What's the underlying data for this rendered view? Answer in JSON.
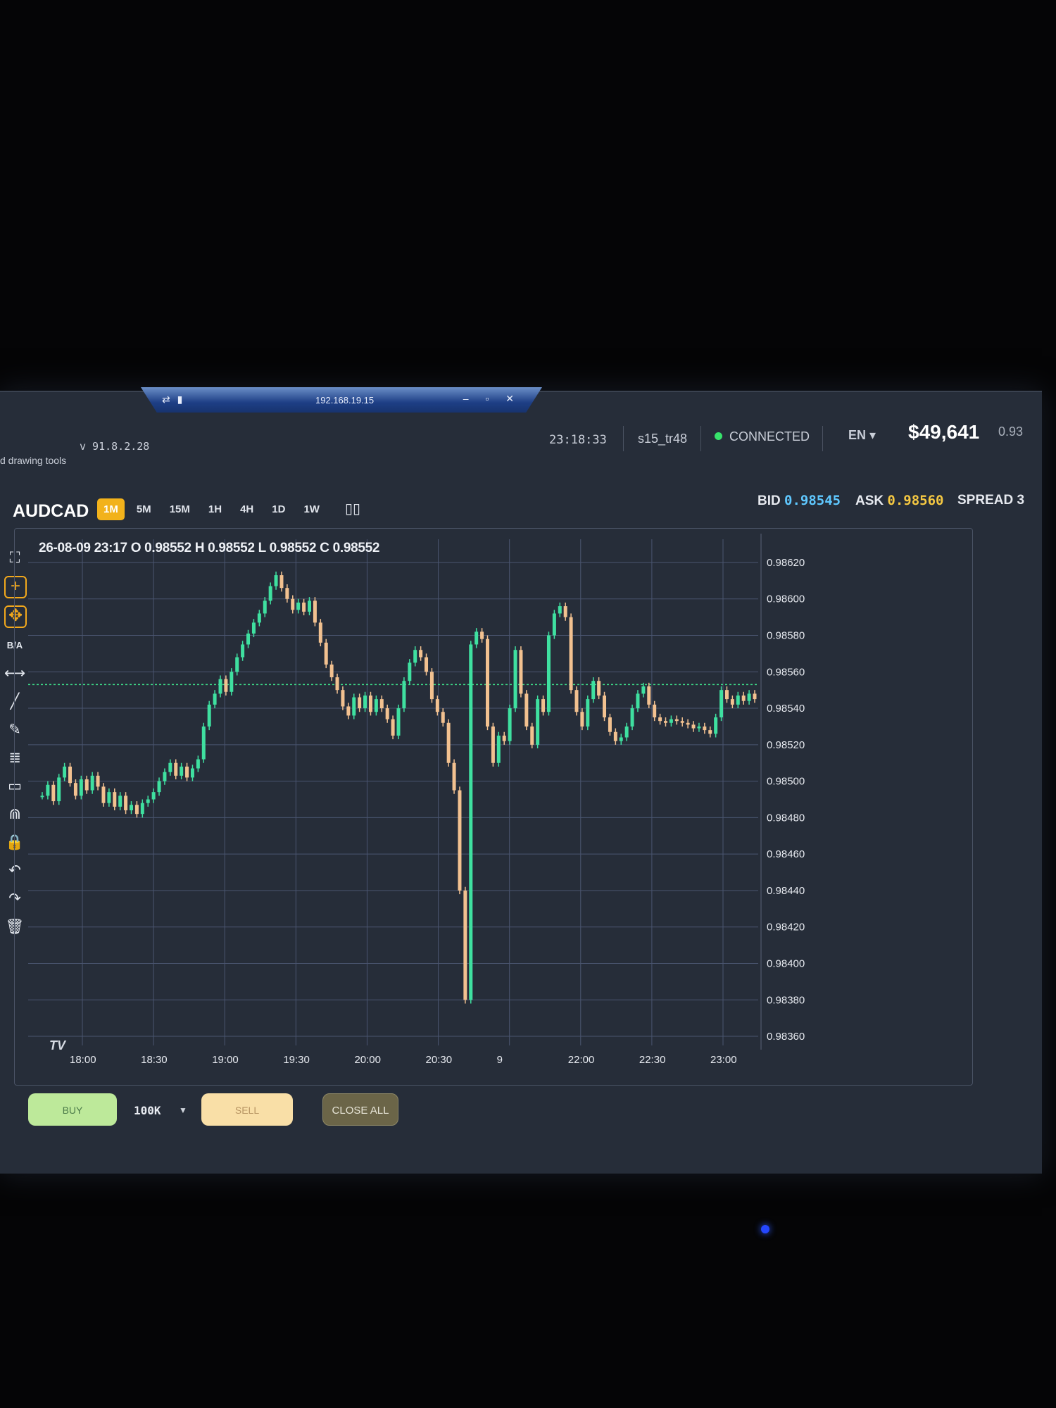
{
  "remote_window": {
    "title": "192.168.19.15",
    "left_icons": "⇄ ▮",
    "controls": "– ▫ ✕"
  },
  "header": {
    "version": "v 91.8.2.28",
    "drawing_tools": "d drawing tools",
    "clock": "23:18:33",
    "user": "s15_tr48",
    "status": "CONNECTED",
    "language": "EN ▾",
    "balance": "$49,641",
    "ratio": "0.93"
  },
  "symbol_bar": {
    "symbol": "AUDCAD",
    "timeframes": [
      "1M",
      "5M",
      "15M",
      "1H",
      "4H",
      "1D",
      "1W"
    ],
    "active_timeframe": "1M",
    "chart_type_icon": "candles-icon",
    "bid_label": "BID",
    "bid_value": "0.98545",
    "ask_label": "ASK",
    "ask_value": "0.98560",
    "spread_label": "SPREAD",
    "spread_value": "3"
  },
  "toolbar": {
    "items": [
      {
        "icon": "fullscreen-icon",
        "glyph": "⛶"
      },
      {
        "icon": "crosshair-icon",
        "glyph": "+"
      },
      {
        "icon": "move-icon",
        "glyph": "✥"
      },
      {
        "icon": "bid-ask-icon",
        "glyph": "B/A"
      },
      {
        "icon": "horizontal-line-icon",
        "glyph": "⟷"
      },
      {
        "icon": "trend-line-icon",
        "glyph": "╱"
      },
      {
        "icon": "pencil-icon",
        "glyph": "✎"
      },
      {
        "icon": "fib-icon",
        "glyph": "≣"
      },
      {
        "icon": "rectangle-icon",
        "glyph": "▭"
      },
      {
        "icon": "magnet-icon",
        "glyph": "⋒"
      },
      {
        "icon": "lock-icon",
        "glyph": "🔒"
      },
      {
        "icon": "undo-icon",
        "glyph": "↶"
      },
      {
        "icon": "redo-icon",
        "glyph": "↷"
      },
      {
        "icon": "trash-icon",
        "glyph": "🗑"
      }
    ]
  },
  "ohlc_legend": "26-08-09 23:17 O 0.98552 H 0.98552 L 0.98552 C 0.98552",
  "tv_logo": "TV",
  "trade_bar": {
    "buy_label": "BUY",
    "quantity": "100K",
    "sell_label": "SELL",
    "close_all_label": "CLOSE ALL"
  },
  "colors": {
    "up": "#3fe0a0",
    "down": "#f2c190",
    "grid": "#4a5570",
    "bid_line": "#3ee08a",
    "accent": "#f2b21b"
  },
  "chart_data": {
    "type": "line",
    "x_ticks": [
      "18:00",
      "18:30",
      "19:00",
      "19:30",
      "20:00",
      "20:30",
      "9",
      "22:00",
      "22:30",
      "23:00"
    ],
    "y_ticks": [
      "0.98620",
      "0.98600",
      "0.98580",
      "0.98560",
      "0.98540",
      "0.98520",
      "0.98500",
      "0.98480",
      "0.98460",
      "0.98440",
      "0.98420",
      "0.98400",
      "0.98380",
      "0.98360"
    ],
    "ylim": [
      0.98355,
      0.98625
    ],
    "bid_line": 0.98553,
    "series": [
      {
        "values": [
          0.98492,
          0.98498,
          0.98489,
          0.98502,
          0.98508,
          0.98499,
          0.98492,
          0.98501,
          0.98495,
          0.98503,
          0.98497,
          0.98488,
          0.98494,
          0.98486,
          0.98492,
          0.98484,
          0.98487,
          0.98482,
          0.98488,
          0.9849,
          0.98494,
          0.985,
          0.98505,
          0.9851,
          0.98503,
          0.98508,
          0.98502,
          0.98507,
          0.98512,
          0.9853,
          0.98542,
          0.98548,
          0.98556,
          0.98549,
          0.9856,
          0.98568,
          0.98575,
          0.98581,
          0.98587,
          0.98592,
          0.98599,
          0.98607,
          0.98613,
          0.98606,
          0.986,
          0.98594,
          0.98598,
          0.98593,
          0.98599,
          0.98587,
          0.98576,
          0.98564,
          0.98557,
          0.9855,
          0.98541,
          0.98536,
          0.98546,
          0.9854,
          0.98547,
          0.98538,
          0.98545,
          0.9854,
          0.98534,
          0.98525,
          0.9854,
          0.98555,
          0.98565,
          0.98572,
          0.98568,
          0.9856,
          0.98545,
          0.98538,
          0.98532,
          0.9851,
          0.98495,
          0.9844,
          0.9838,
          0.98575,
          0.98582,
          0.98578,
          0.9853,
          0.9851,
          0.98525,
          0.98522,
          0.9854,
          0.98572,
          0.98548,
          0.9853,
          0.9852,
          0.98545,
          0.98538,
          0.9858,
          0.98592,
          0.98596,
          0.9859,
          0.9855,
          0.98538,
          0.9853,
          0.98545,
          0.98555,
          0.98547,
          0.98535,
          0.98527,
          0.98522,
          0.98524,
          0.9853,
          0.9854,
          0.98548,
          0.98552,
          0.98542,
          0.98535,
          0.98533,
          0.98532,
          0.98534,
          0.98533,
          0.98532,
          0.98531,
          0.98529,
          0.9853,
          0.98528,
          0.98526,
          0.98535,
          0.9855,
          0.98545,
          0.98542,
          0.98547,
          0.98544,
          0.98548,
          0.98545
        ]
      }
    ]
  }
}
